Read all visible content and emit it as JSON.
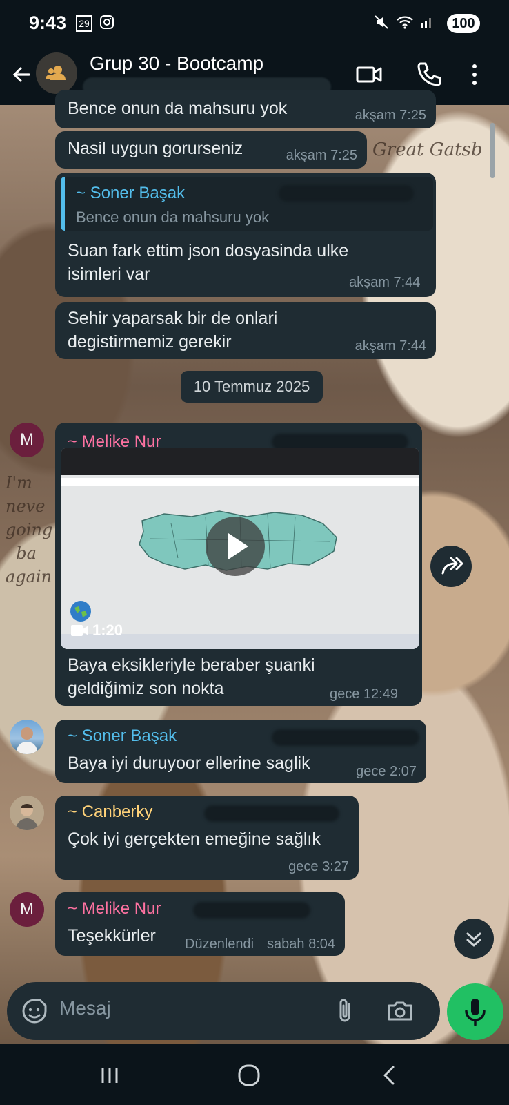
{
  "status_bar": {
    "time": "9:43",
    "battery": "100",
    "calendar_day": "29"
  },
  "header": {
    "title": "Grup 30 - Bootcamp"
  },
  "messages": [
    {
      "text": "Bence onun da mahsuru yok",
      "time": "akşam 7:25"
    },
    {
      "text": "Nasil uygun gorurseniz",
      "time": "akşam 7:25"
    },
    {
      "reply_author": "~ Soner Başak",
      "reply_text": "Bence onun da mahsuru yok",
      "text": "Suan fark ettim json dosyasinda ulke isimleri var",
      "time": "akşam 7:44"
    },
    {
      "text": "Sehir yaparsak bir de onlari degistirmemiz gerekir",
      "time": "akşam 7:44"
    }
  ],
  "date_separator": "10 Temmuz 2025",
  "video_message": {
    "sender": "~ Melike Nur",
    "avatar_letter": "M",
    "duration": "1:20",
    "caption": "Baya eksikleriyle beraber şuanki geldiğimiz son nokta",
    "time": "gece 12:49"
  },
  "group_messages": [
    {
      "sender": "~ Soner Başak",
      "text": "Baya iyi duruyoor ellerine saglik",
      "time": "gece 2:07"
    },
    {
      "sender": "~ Canberky",
      "text": "Çok iyi gerçekten emeğine sağlık",
      "time": "gece 3:27"
    },
    {
      "sender": "~ Melike Nur",
      "avatar_letter": "M",
      "text": "Teşekkürler",
      "edited": "Düzenlendi",
      "time": "sabah 8:04"
    }
  ],
  "composer": {
    "placeholder": "Mesaj"
  },
  "colors": {
    "melike": "#ff72a1",
    "soner": "#53bdeb",
    "canberky": "#ffd279",
    "mic": "#21c063"
  }
}
